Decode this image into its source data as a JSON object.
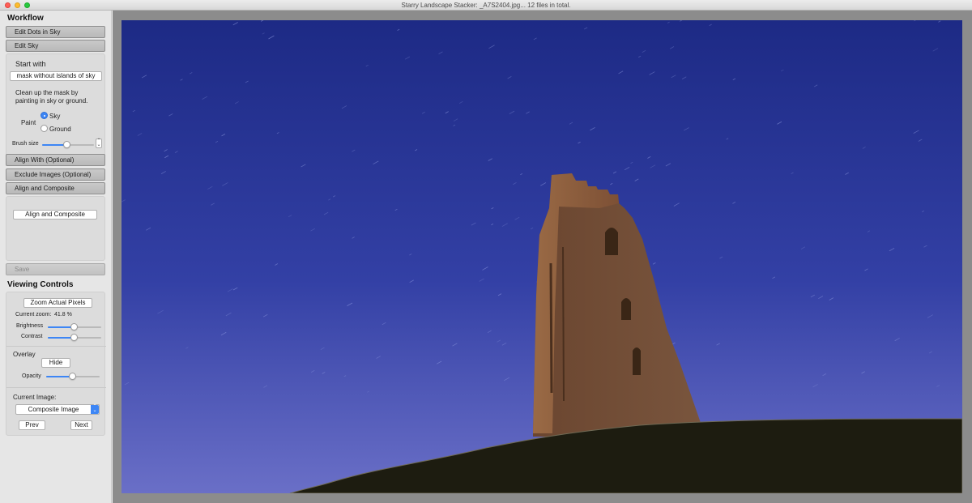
{
  "window": {
    "title": "Starry Landscape Stacker: _A7S2404.jpg...   12 files in total."
  },
  "workflow": {
    "title": "Workflow",
    "steps": {
      "edit_dots": "Edit Dots in Sky",
      "edit_sky": "Edit Sky",
      "align_with": "Align With (Optional)",
      "exclude_images": "Exclude Images (Optional)",
      "align_composite": "Align and Composite",
      "save": "Save"
    },
    "edit_sky": {
      "start_with_label": "Start with",
      "start_with_value": "mask without islands of sky",
      "instructions": "Clean up the mask by painting in sky or ground.",
      "paint_label": "Paint",
      "paint_options": [
        "Sky",
        "Ground"
      ],
      "paint_selected": "Sky",
      "brush_size_label": "Brush size",
      "brush_size": 0.48
    },
    "align_composite_button": "Align and Composite"
  },
  "viewing": {
    "title": "Viewing Controls",
    "zoom_button": "Zoom Actual Pixels",
    "current_zoom_label": "Current zoom:",
    "current_zoom_value": "41.8 %",
    "brightness_label": "Brightness",
    "brightness": 0.5,
    "contrast_label": "Contrast",
    "contrast": 0.5,
    "overlay_label": "Overlay",
    "overlay_button": "Hide",
    "opacity_label": "Opacity",
    "opacity": 0.5,
    "current_image_label": "Current Image:",
    "current_image_value": "Composite Image",
    "prev_button": "Prev",
    "next_button": "Next"
  },
  "colors": {
    "accent": "#3d86f5",
    "sky_top": "#1d2a85",
    "sky_bottom": "#6a6fc7",
    "tower": "#8a5a3c",
    "hill": "#1d1c10"
  }
}
